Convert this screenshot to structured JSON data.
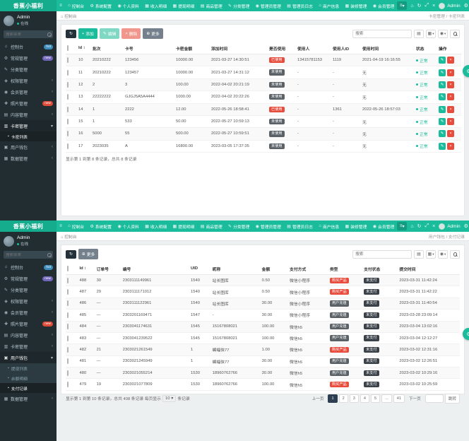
{
  "theme": {
    "green": "#1abc9c",
    "green_dark": "#149c82",
    "sidebar": "#222d32",
    "red": "#e74c3c",
    "dark_btn": "#24313a",
    "gray_btn": "#74808c",
    "teal_light": "#7fd8c3",
    "red_light": "#f0968c",
    "badge_dark": "#5a6268",
    "badge_darker": "#3a4148",
    "pager_active": "#2c3e50",
    "badge_hot": "#3c8dbc",
    "badge_new_purple": "#7266ba",
    "badge_new_red": "#dd4b39"
  },
  "icons": {
    "menu": "≡",
    "caret_down": "▾",
    "chevron_left": "‹",
    "home": "⌂",
    "gear": "⚙",
    "user": "◉",
    "chart": "▦",
    "doc": "▤",
    "pencil": "✎",
    "refresh": "↻",
    "plus": "+",
    "more": "⊕",
    "close": "×",
    "moon": "☾",
    "expand": "⤢",
    "dot": "●",
    "sort": "↕",
    "sub_dot": "▪",
    "wallet": "▣",
    "card": "▥",
    "lock": "◈",
    "photo": "✚"
  },
  "header": {
    "logo": "香蕉小福利",
    "nav_items": [
      {
        "label": "控制台",
        "icon": "home"
      },
      {
        "label": "系统配置",
        "icon": "gear"
      },
      {
        "label": "个人资料",
        "icon": "user"
      },
      {
        "label": "收入明细",
        "icon": "chart"
      },
      {
        "label": "提现明细",
        "icon": "chart"
      },
      {
        "label": "商品管理",
        "icon": "doc"
      },
      {
        "label": "分类管理",
        "icon": "pencil"
      },
      {
        "label": "管理员管理",
        "icon": "user"
      },
      {
        "label": "管理员日志",
        "icon": "doc"
      },
      {
        "label": "商户信息",
        "icon": "home"
      },
      {
        "label": "装修管理",
        "icon": "chart"
      },
      {
        "label": "会员管理",
        "icon": "user"
      }
    ],
    "right": {
      "user": "Admin"
    }
  },
  "sidebar": {
    "user_name": "Admin",
    "user_status": "在线",
    "search_placeholder": "搜索菜单",
    "items": [
      {
        "label": "控制台",
        "icon": "home",
        "badge": "hot",
        "badge_color": "#3c8dbc"
      },
      {
        "label": "常规管理",
        "icon": "gear",
        "badge": "new",
        "badge_color": "#7266ba"
      },
      {
        "label": "分类管理",
        "icon": "pencil"
      },
      {
        "label": "权限管理",
        "icon": "lock",
        "arrow": true
      },
      {
        "label": "会员管理",
        "icon": "user",
        "arrow": true
      },
      {
        "label": "照片管理",
        "icon": "photo",
        "badge": "new",
        "badge_color": "#dd4b39"
      },
      {
        "label": "内容管理",
        "icon": "doc",
        "arrow": true
      },
      {
        "label": "卡密管理",
        "icon": "card",
        "arrow": true,
        "key": "cards"
      },
      {
        "label": "用户钱包",
        "icon": "wallet",
        "arrow": true,
        "key": "wallet"
      },
      {
        "label": "数据管理",
        "icon": "chart",
        "arrow": true
      }
    ]
  },
  "badge_colors": {
    "已使用": "#e74c3c",
    "未使用": "#5a6268",
    "购买产品": "#e74c3c",
    "用户充值": "#5a6268",
    "未支付": "#3a4148"
  },
  "shots": [
    {
      "breadcrumb": "控制台",
      "crumbs_right": "卡密管理 / 卡密列表",
      "expanded": "cards",
      "submenu": {
        "cards": [
          {
            "label": "卡密列表",
            "active": true
          }
        ]
      },
      "toolbar": [
        {
          "name": "refresh-button",
          "icon": "refresh",
          "label": "",
          "color": "#24313a"
        },
        {
          "name": "add-button",
          "icon": "plus",
          "label": "添加",
          "color": "#1abc9c"
        },
        {
          "name": "edit-button",
          "icon": "pencil",
          "label": "编辑",
          "color": "#7fd8c3"
        },
        {
          "name": "delete-button",
          "icon": "close",
          "label": "删除",
          "color": "#f0968c"
        },
        {
          "name": "more-button",
          "icon": "more",
          "label": "更多",
          "color": "#74808c"
        }
      ],
      "search_placeholder": "搜索",
      "table": {
        "columns": [
          {
            "label": "",
            "type": "check"
          },
          {
            "label": "Id",
            "type": "text",
            "sort": true
          },
          {
            "label": "批次",
            "type": "text"
          },
          {
            "label": "卡号",
            "type": "text"
          },
          {
            "label": "卡密金额",
            "type": "text"
          },
          {
            "label": "添加时间",
            "type": "text"
          },
          {
            "label": "是否使用",
            "type": "badge"
          },
          {
            "label": "使用人",
            "type": "text"
          },
          {
            "label": "使用人ID",
            "type": "text"
          },
          {
            "label": "使用时间",
            "type": "text"
          },
          {
            "label": "状态",
            "type": "status"
          },
          {
            "label": "操作",
            "type": "ops"
          }
        ],
        "rows": [
          [
            "10",
            "20210222",
            "123456",
            "10000.00",
            "2021-03-27 14:30:51",
            "已使用",
            "13415781153",
            "1119",
            "2021-04-19 16:16:55",
            "正常"
          ],
          [
            "11",
            "20210222",
            "123457",
            "10000.00",
            "2021-03-27 14:31:12",
            "未使用",
            "-",
            "-",
            "无",
            "正常"
          ],
          [
            "12",
            "2",
            "3",
            "100.00",
            "2022-04-02 20:21:19",
            "未使用",
            "-",
            "-",
            "无",
            "正常"
          ],
          [
            "13",
            "22222222",
            "GJGJ5A5A4444",
            "1000.00",
            "2022-04-02 20:22:26",
            "未使用",
            "-",
            "-",
            "无",
            "正常"
          ],
          [
            "14",
            "1",
            "2222",
            "12.00",
            "2022-05-26 18:58:41",
            "已使用",
            "-",
            "1361",
            "2022-05-26 18:57:03",
            "正常"
          ],
          [
            "15",
            "1",
            "533",
            "50.00",
            "2022-05-27 10:59:13",
            "未使用",
            "-",
            "-",
            "无",
            "正常"
          ],
          [
            "16",
            "5000",
            "55",
            "500.00",
            "2022-05-27 10:59:51",
            "未使用",
            "-",
            "-",
            "无",
            "正常"
          ],
          [
            "17",
            "2023035",
            "A",
            "16800.00",
            "2023-03-05 17:37:35",
            "未使用",
            "-",
            "-",
            "无",
            "正常"
          ]
        ],
        "widths": [
          16,
          20,
          46,
          72,
          50,
          82,
          40,
          50,
          42,
          76,
          32,
          34
        ]
      },
      "summary": "显示第 1 到第 8 条记录，总共 8 条记录"
    },
    {
      "breadcrumb": "控制台",
      "crumbs_right": "用户钱包 / 支付记录",
      "expanded": "wallet",
      "submenu": {
        "wallet": [
          {
            "label": "提现列表"
          },
          {
            "label": "余额明细"
          },
          {
            "label": "支付记录",
            "active": true
          }
        ]
      },
      "toolbar": [
        {
          "name": "refresh-button",
          "icon": "refresh",
          "label": "",
          "color": "#24313a"
        },
        {
          "name": "more-button",
          "icon": "more",
          "label": "更多",
          "color": "#74808c"
        }
      ],
      "search_placeholder": "搜索",
      "table": {
        "columns": [
          {
            "label": "",
            "type": "check"
          },
          {
            "label": "Id",
            "type": "text",
            "sort": true
          },
          {
            "label": "订单号",
            "type": "text"
          },
          {
            "label": "编号",
            "type": "text"
          },
          {
            "label": "UID",
            "type": "text"
          },
          {
            "label": "昵称",
            "type": "text"
          },
          {
            "label": "金额",
            "type": "text"
          },
          {
            "label": "支付方式",
            "type": "text"
          },
          {
            "label": "类型",
            "type": "badge"
          },
          {
            "label": "支付状态",
            "type": "badge"
          },
          {
            "label": "提交时间",
            "type": "text"
          }
        ],
        "rows": [
          [
            "488",
            "30",
            "2303111149961",
            "1540",
            "站长图库",
            "0.50",
            "微信小程序",
            "购买产品",
            "未支付",
            "2023-03-31 11:42:24"
          ],
          [
            "487",
            "29",
            "2303111171012",
            "1540",
            "站长图库",
            "0.50",
            "微信小程序",
            "购买产品",
            "未支付",
            "2023-03-31 11:42:22"
          ],
          [
            "486",
            "—",
            "2303111122961",
            "1540",
            "站长图库",
            "30.00",
            "微信小程序",
            "用户充值",
            "未支付",
            "2023-03-31 11:40:54"
          ],
          [
            "485",
            "—",
            "2303201169471",
            "1547",
            "-",
            "30.00",
            "微信小程序",
            "用户充值",
            "未支付",
            "2023-03-28 23:09:14"
          ],
          [
            "484",
            "—",
            "2303041174631",
            "1545",
            "15167808021",
            "100.00",
            "微信h5",
            "用户充值",
            "未支付",
            "2023-03-04 13:02:16"
          ],
          [
            "483",
            "—",
            "2303041239522",
            "1545",
            "15167808021",
            "100.00",
            "微信h5",
            "用户充值",
            "未支付",
            "2023-03-04 12:12:27"
          ],
          [
            "482",
            "21",
            "2303021261549",
            "1",
            "蝙蝠侠77",
            "1.00",
            "微信h5",
            "购买产品",
            "未支付",
            "2023-03-02 12:31:16"
          ],
          [
            "481",
            "—",
            "2303021245949",
            "1",
            "蝙蝠侠77",
            "30.00",
            "微信h5",
            "用户充值",
            "未支付",
            "2023-03-02 12:26:51"
          ],
          [
            "480",
            "—",
            "2303021055214",
            "1530",
            "18960762766",
            "30.00",
            "微信h5",
            "用户充值",
            "未支付",
            "2023-03-02 10:29:16"
          ],
          [
            "479",
            "19",
            "2303021077809",
            "1530",
            "18960762766",
            "100.00",
            "微信h5",
            "购买产品",
            "未支付",
            "2023-03-02 10:25:59"
          ]
        ],
        "widths": [
          16,
          22,
          34,
          88,
          28,
          64,
          36,
          52,
          44,
          46,
          80
        ]
      },
      "summary": "显示第 1 到第 10 条记录，总共 408 条记录  每页显示",
      "page_size": "10",
      "summary_suffix": "条记录",
      "pagination": {
        "prev": "上一页",
        "pages": [
          "1",
          "2",
          "3",
          "4",
          "5",
          "...",
          "41"
        ],
        "active": "1",
        "next": "下一页",
        "jump": "跳转"
      }
    }
  ]
}
